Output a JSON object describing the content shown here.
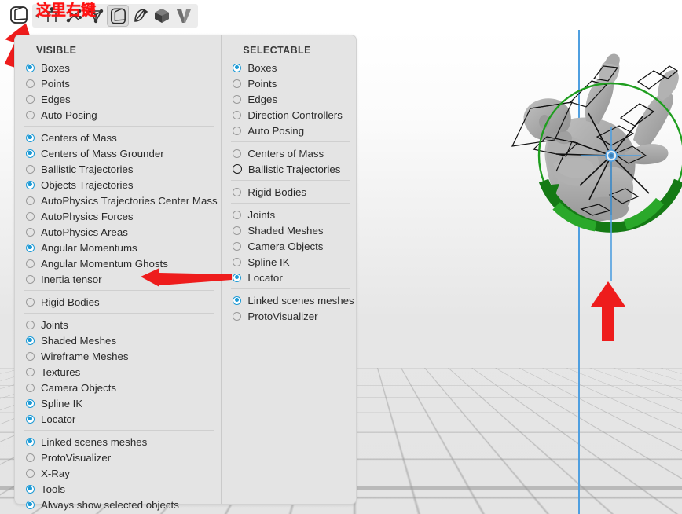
{
  "annotation": {
    "toolbar_hint": "这里右键",
    "arrow_color": "#ee1c1c"
  },
  "toolbar": {
    "icons": [
      {
        "name": "cube-outline-icon",
        "active": false
      },
      {
        "name": "joint-rig-icon",
        "active": false
      },
      {
        "name": "skeleton-nodes-icon",
        "active": false
      },
      {
        "name": "triangle-mesh-icon",
        "active": false
      },
      {
        "name": "shaded-box-icon",
        "active": true
      },
      {
        "name": "wireframe-sliver-icon",
        "active": false
      },
      {
        "name": "solid-cube-icon",
        "active": false
      },
      {
        "name": "vee-shape-icon",
        "active": false
      }
    ]
  },
  "panel": {
    "visible": {
      "title": "VISIBLE",
      "groups": [
        {
          "items": [
            {
              "label": "Boxes",
              "state": "on"
            },
            {
              "label": "Points",
              "state": "off"
            },
            {
              "label": "Edges",
              "state": "off"
            },
            {
              "label": "Auto Posing",
              "state": "off"
            }
          ]
        },
        {
          "items": [
            {
              "label": "Centers of Mass",
              "state": "on"
            },
            {
              "label": "Centers of Mass Grounder",
              "state": "on"
            },
            {
              "label": "Ballistic Trajectories",
              "state": "off"
            },
            {
              "label": "Objects Trajectories",
              "state": "on"
            },
            {
              "label": "AutoPhysics Trajectories Center Mass",
              "state": "off"
            },
            {
              "label": "AutoPhysics Forces",
              "state": "off"
            },
            {
              "label": "AutoPhysics Areas",
              "state": "off"
            },
            {
              "label": "Angular Momentums",
              "state": "on"
            },
            {
              "label": "Angular Momentum Ghosts",
              "state": "off"
            },
            {
              "label": "Inertia tensor",
              "state": "off"
            }
          ]
        },
        {
          "items": [
            {
              "label": "Rigid Bodies",
              "state": "off"
            }
          ]
        },
        {
          "items": [
            {
              "label": "Joints",
              "state": "off"
            },
            {
              "label": "Shaded Meshes",
              "state": "on"
            },
            {
              "label": "Wireframe Meshes",
              "state": "off"
            },
            {
              "label": "Textures",
              "state": "off"
            },
            {
              "label": "Camera Objects",
              "state": "off"
            },
            {
              "label": "Spline IK",
              "state": "on"
            },
            {
              "label": "Locator",
              "state": "on"
            }
          ]
        },
        {
          "items": [
            {
              "label": "Linked scenes meshes",
              "state": "on"
            },
            {
              "label": "ProtoVisualizer",
              "state": "off"
            },
            {
              "label": "X-Ray",
              "state": "off"
            },
            {
              "label": "Tools",
              "state": "on"
            },
            {
              "label": "Always show selected objects",
              "state": "on"
            }
          ]
        }
      ]
    },
    "selectable": {
      "title": "SELECTABLE",
      "groups": [
        {
          "items": [
            {
              "label": "Boxes",
              "state": "on"
            },
            {
              "label": "Points",
              "state": "off"
            },
            {
              "label": "Edges",
              "state": "off"
            },
            {
              "label": "Direction Controllers",
              "state": "off"
            },
            {
              "label": "Auto Posing",
              "state": "off"
            }
          ]
        },
        {
          "items": [
            {
              "label": "Centers of Mass",
              "state": "off"
            },
            {
              "label": "Ballistic Trajectories",
              "state": "hover"
            }
          ]
        },
        {
          "items": [
            {
              "label": "Rigid Bodies",
              "state": "off"
            }
          ]
        },
        {
          "items": [
            {
              "label": "Joints",
              "state": "off"
            },
            {
              "label": "Shaded Meshes",
              "state": "off"
            },
            {
              "label": "Camera Objects",
              "state": "off"
            },
            {
              "label": "Spline IK",
              "state": "off"
            },
            {
              "label": "Locator",
              "state": "on"
            }
          ]
        },
        {
          "items": [
            {
              "label": "Linked scenes meshes",
              "state": "on"
            },
            {
              "label": "ProtoVisualizer",
              "state": "off"
            }
          ]
        }
      ]
    }
  },
  "viewport": {
    "gizmo": {
      "name": "angular-momentum-ring",
      "ring_color": "#1f9e1f",
      "arc_color": "#157a15",
      "axis_color": "#4f9fe0"
    },
    "character": {
      "name": "character-mesh",
      "mesh_color": "#a9a9a9"
    },
    "ground": {
      "name": "ground-grid",
      "grid_color": "#969696"
    }
  }
}
